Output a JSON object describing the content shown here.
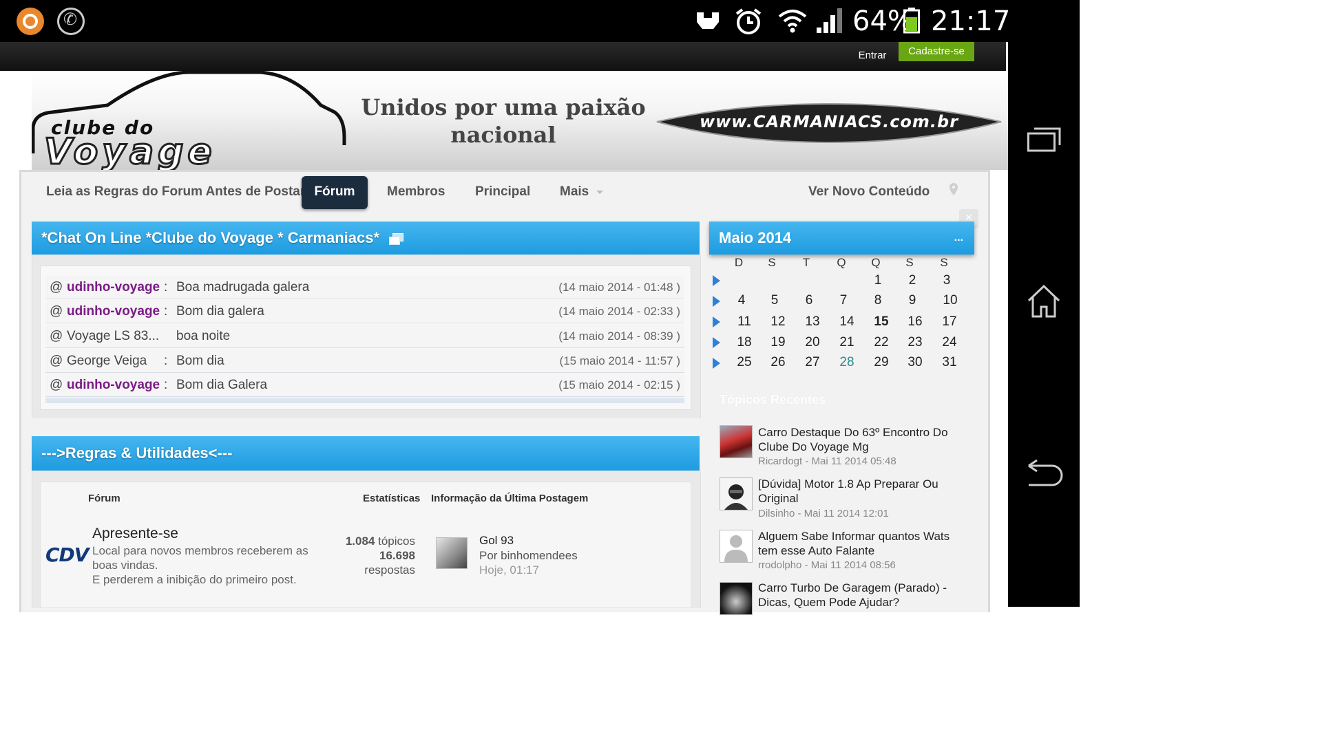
{
  "status_bar": {
    "battery": "64%",
    "time": "21:17"
  },
  "header": {
    "login": "Entrar",
    "register": "Cadastre-se"
  },
  "banner": {
    "logo_top": "clube do",
    "logo_bottom": "Voyage",
    "slogan_line1": "Unidos por uma paixão",
    "slogan_line2": "nacional",
    "partner": "www.CARMANIACS.com.br"
  },
  "nav": {
    "items": [
      "Leia as Regras do Forum Antes de Postar",
      "Fórum",
      "Membros",
      "Principal",
      "Mais"
    ],
    "right": "Ver Novo Conteúdo"
  },
  "chat": {
    "title": "*Chat On Line *Clube do Voyage * Carmaniacs*",
    "messages": [
      {
        "at": "@",
        "nick": "udinho-voyage",
        "sep": ":",
        "msg": "Boa madrugada galera",
        "time": "(14 maio 2014 - 01:48 )"
      },
      {
        "at": "@",
        "nick": "udinho-voyage",
        "sep": ":",
        "msg": "Bom dia galera",
        "time": "(14 maio 2014 - 02:33 )"
      },
      {
        "at": "@",
        "nick": "Voyage LS 83...",
        "sep": ":",
        "msg": "boa noite",
        "time": "(14 maio 2014 - 08:39 )"
      },
      {
        "at": "@",
        "nick": "George Veiga",
        "sep": ":",
        "msg": "Bom dia",
        "time": "(15 maio 2014 - 11:57 )"
      },
      {
        "at": "@",
        "nick": "udinho-voyage",
        "sep": ":",
        "msg": "Bom dia Galera",
        "time": "(15 maio 2014 - 02:15 )"
      }
    ]
  },
  "rules": {
    "title": "--->Regras & Utilidades<---",
    "col_forum": "Fórum",
    "col_stats": "Estatísticas",
    "col_last": "Informação da Última Postagem",
    "forum": {
      "icon_text": "CDV",
      "name": "Apresente-se",
      "desc1": "Local para novos membros receberem as",
      "desc2": "boas vindas.",
      "desc3": "E perderem a inibição do primeiro post.",
      "topics_num": "1.084",
      "topics_label": "tópicos",
      "replies_num": "16.698",
      "replies_label": "respostas",
      "last_title": "Gol 93",
      "last_by": "Por binhomendees",
      "last_time": "Hoje, 01:17"
    }
  },
  "calendar": {
    "title": "Maio 2014",
    "more": "...",
    "close": "×",
    "day_names": [
      "D",
      "S",
      "T",
      "Q",
      "Q",
      "S",
      "S"
    ],
    "weeks": [
      [
        "",
        "",
        "",
        "",
        "1",
        "2",
        "3"
      ],
      [
        "4",
        "5",
        "6",
        "7",
        "8",
        "9",
        "10"
      ],
      [
        "11",
        "12",
        "13",
        "14",
        "15",
        "16",
        "17"
      ],
      [
        "18",
        "19",
        "20",
        "21",
        "22",
        "23",
        "24"
      ],
      [
        "25",
        "26",
        "27",
        "28",
        "29",
        "30",
        "31"
      ]
    ],
    "today": "15",
    "highlight": "28"
  },
  "recent": {
    "title": "Tópicos Recentes",
    "items": [
      {
        "title": "Carro Destaque Do 63º Encontro Do Clube Do Voyage Mg",
        "meta": "Ricardogt - Mai 11 2014 05:48"
      },
      {
        "title": "[Dúvida] Motor 1.8 Ap Preparar Ou Original",
        "meta": "Dilsinho - Mai 11 2014 12:01"
      },
      {
        "title": "Alguem Sabe Informar quantos Wats tem esse Auto Falante",
        "meta": "rrodolpho - Mai 11 2014 08:56"
      },
      {
        "title": "Carro Turbo De Garagem (Parado) - Dicas, Quem Pode Ajudar?",
        "meta": ""
      }
    ]
  },
  "colors": {
    "header_blue": "#1e9be0",
    "register_green": "#6aa614",
    "member_purple": "#7a1c86",
    "highlight_teal": "#2a8a8a"
  }
}
